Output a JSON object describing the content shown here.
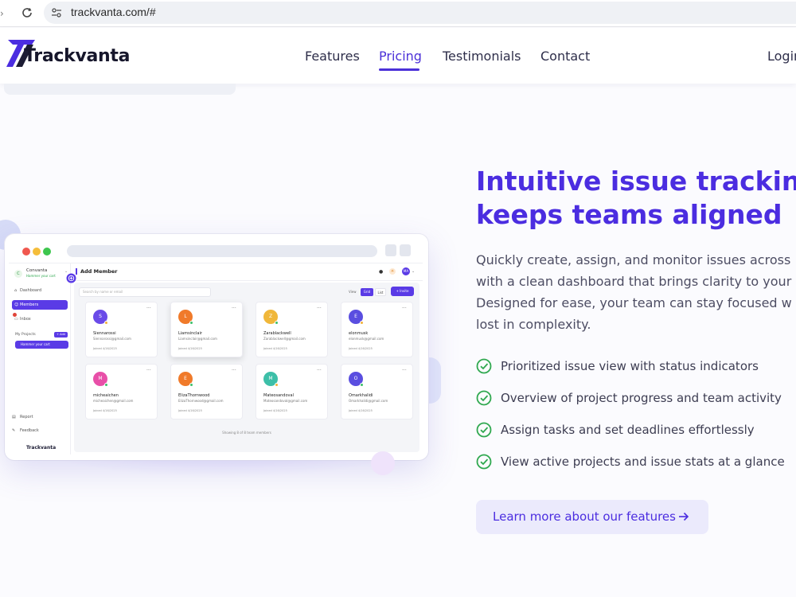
{
  "browser": {
    "url": "trackvanta.com/#"
  },
  "header": {
    "brand": "Trackvanta",
    "nav": [
      "Features",
      "Pricing",
      "Testimonials",
      "Contact"
    ],
    "active_nav": "Pricing",
    "login": "Login"
  },
  "mockup": {
    "org_name": "Convanta",
    "org_sub": "Hammer your cart",
    "sidebar": [
      "Dashboard",
      "Members",
      "Inbox"
    ],
    "my_projects": "My Projects",
    "add": "+ Add",
    "project_select": "Hammer your cart",
    "report": "Report",
    "feedback": "Feedback",
    "logo": "Trackvanta",
    "title": "Add Member",
    "user_initials": "MA",
    "search_placeholder": "Search by name or email",
    "view_label": "View",
    "view_options": [
      "Grid",
      "List"
    ],
    "invite": "+ Invite",
    "members": [
      {
        "initial": "S",
        "name": "Siennarossi",
        "email": "Siennarossi@gmail.com",
        "joined": "Joined 4/16/2025",
        "color": "#6a4be8",
        "status": "#f2b23a"
      },
      {
        "initial": "L",
        "name": "Liamsinclair",
        "email": "Liamsinclair@gmail.com",
        "joined": "Joined 4/16/2025",
        "color": "#f07a2a",
        "status": "#3cc06a"
      },
      {
        "initial": "Z",
        "name": "Zarablackwell",
        "email": "Zarablackwell@gmail.com",
        "joined": "Joined 4/16/2025",
        "color": "#f0b73a",
        "status": "#3cc06a"
      },
      {
        "initial": "E",
        "name": "elonmusk",
        "email": "elonmusk@gmail.com",
        "joined": "Joined 4/16/2025",
        "color": "#5a4ee0",
        "status": "#f2b23a"
      },
      {
        "initial": "M",
        "name": "micheaichen",
        "email": "micheaichen@gmail.com",
        "joined": "Joined 4/16/2025",
        "color": "#e84fa8",
        "status": "#3cc06a"
      },
      {
        "initial": "E",
        "name": "ElizaThornwood",
        "email": "ElizaThornwood@gmail.com",
        "joined": "Joined 4/16/2025",
        "color": "#f07a2a",
        "status": "#3cc06a"
      },
      {
        "initial": "M",
        "name": "Mateosandoval",
        "email": "Mateosandoval@gmail.com",
        "joined": "Joined 4/16/2025",
        "color": "#3dbfa8",
        "status": "#f2b23a"
      },
      {
        "initial": "O",
        "name": "Omarkhalidi",
        "email": "Omarkhalidi@gmail.com",
        "joined": "Joined 4/16/2025",
        "color": "#5a4ee0",
        "status": "#3cc06a"
      }
    ],
    "footer": "Showing 8 of 8 team members"
  },
  "hero": {
    "title_lines": [
      "Intuitive issue tracking t",
      "keeps teams aligned"
    ],
    "description_lines": [
      "Quickly create, assign, and monitor issues across",
      "with a clean dashboard that brings clarity to your",
      "Designed for ease, your team can stay focused w",
      "lost in complexity."
    ],
    "features": [
      "Prioritized issue view with status indicators",
      "Overview of project progress and team activity",
      "Assign tasks and set deadlines effortlessly",
      "View active projects and issue stats at a glance"
    ],
    "cta": "Learn more about our features"
  },
  "colors": {
    "accent": "#4b2de0",
    "check": "#2fa84f",
    "cta_bg": "#ebeafc"
  }
}
